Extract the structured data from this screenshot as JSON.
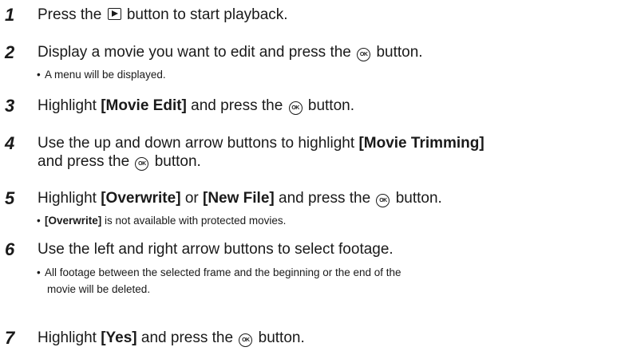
{
  "steps": [
    {
      "num": "1",
      "pre": "Press the",
      "post": "button to start playback."
    },
    {
      "num": "2",
      "pre": "Display a movie you want to edit and press the",
      "post": "button.",
      "note": "A menu will be displayed."
    },
    {
      "num": "3",
      "pre": "Highlight",
      "bold": "[Movie Edit]",
      "mid": "and press the",
      "post": "button."
    },
    {
      "num": "4",
      "line1_pre": "Use the up and down arrow buttons to highlight",
      "line1_bold": "[Movie Trimming]",
      "line2_pre": "and press the",
      "line2_post": "button."
    },
    {
      "num": "5",
      "pre": "Highlight",
      "bold1": "[Overwrite]",
      "or": "or",
      "bold2": "[New File]",
      "mid": "and press the",
      "post": "button.",
      "note_bold": "[Overwrite]",
      "note_rest": "is not available with protected movies."
    },
    {
      "num": "6",
      "text": "Use the left and right arrow buttons to select footage.",
      "note_line1": "All footage between the selected frame and the beginning or the end of the",
      "note_line2": "movie will be deleted."
    },
    {
      "num": "7",
      "pre": "Highlight",
      "bold": "[Yes]",
      "mid": "and press the",
      "post": "button."
    }
  ],
  "icons": {
    "play": "playback-icon",
    "ok": "ok-button-icon",
    "ok_label": "OK"
  }
}
